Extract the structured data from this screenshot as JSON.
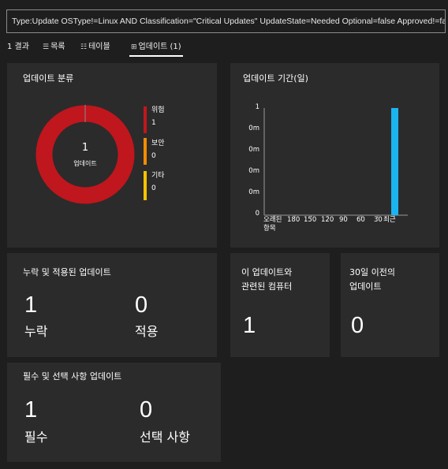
{
  "query": "Type:Update OSType!=Linux AND Classification=\"Critical Updates\" UpdateState=Needed Optional=false Approved!=false",
  "tabs": [
    {
      "label": "1 결과",
      "icon": ""
    },
    {
      "label": "목록",
      "icon": "list-icon"
    },
    {
      "label": "테이블",
      "icon": "table-icon"
    },
    {
      "label": "업데이트 (1)",
      "icon": "tile-icon",
      "active": true
    }
  ],
  "classification": {
    "title": "업데이트 분류",
    "center_value": "1",
    "center_label": "업데이트",
    "legend": [
      {
        "name": "위험",
        "value": "1",
        "color": "#c0161d"
      },
      {
        "name": "보안",
        "value": "0",
        "color": "#f28c00"
      },
      {
        "name": "기타",
        "value": "0",
        "color": "#f7c300"
      }
    ]
  },
  "age": {
    "title": "업데이트 기간(일)",
    "y_ticks": [
      "1",
      "0m",
      "0m",
      "0m",
      "0m",
      "0"
    ],
    "x_ticks": [
      "오래된\n항목",
      "180",
      "150",
      "120",
      "90",
      "60",
      "30",
      "최근"
    ],
    "bar_color": "#1ab4f0"
  },
  "chart_data": [
    {
      "type": "pie",
      "title": "업데이트 분류",
      "labels": [
        "위험",
        "보안",
        "기타"
      ],
      "values": [
        1,
        0,
        0
      ],
      "colors": [
        "#c0161d",
        "#f28c00",
        "#f7c300"
      ]
    },
    {
      "type": "bar",
      "title": "업데이트 기간(일)",
      "categories": [
        "오래된 항목",
        "180",
        "150",
        "120",
        "90",
        "60",
        "30",
        "최근"
      ],
      "values": [
        0,
        0,
        0,
        0,
        0,
        0,
        0,
        1
      ],
      "ylim": [
        0,
        1
      ]
    }
  ],
  "missing_applied": {
    "title": "누락 및 적용된 업데이트",
    "missing_value": "1",
    "missing_label": "누락",
    "applied_value": "0",
    "applied_label": "적용"
  },
  "related_computers": {
    "title": "이 업데이트와\n관련된 컴퓨터",
    "value": "1"
  },
  "older_30": {
    "title": "30일 이전의\n업데이트",
    "value": "0"
  },
  "required_optional": {
    "title": "필수 및 선택 사항 업데이트",
    "required_value": "1",
    "required_label": "필수",
    "optional_value": "0",
    "optional_label": "선택 사항"
  }
}
